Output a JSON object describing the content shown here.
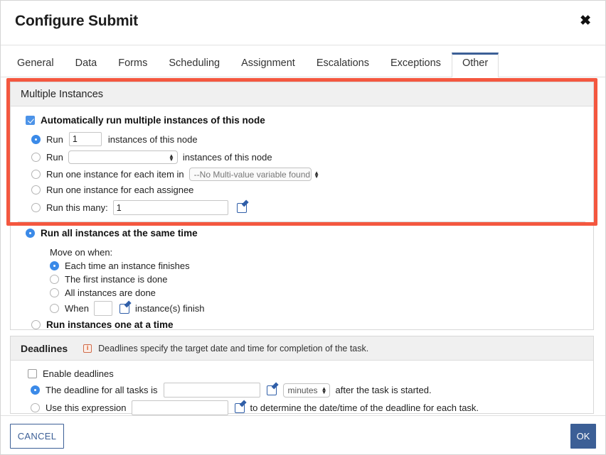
{
  "dialog": {
    "title": "Configure Submit",
    "close_label": "✖"
  },
  "tabs": [
    {
      "label": "General",
      "active": false
    },
    {
      "label": "Data",
      "active": false
    },
    {
      "label": "Forms",
      "active": false
    },
    {
      "label": "Scheduling",
      "active": false
    },
    {
      "label": "Assignment",
      "active": false
    },
    {
      "label": "Escalations",
      "active": false
    },
    {
      "label": "Exceptions",
      "active": false
    },
    {
      "label": "Other",
      "active": true
    }
  ],
  "multiple_instances": {
    "section_title": "Multiple Instances",
    "auto_run_label": "Automatically run multiple instances of this node",
    "auto_run_checked": true,
    "run_count": {
      "prefix": "Run",
      "value": "1",
      "suffix": "instances of this node",
      "selected": true
    },
    "run_variable": {
      "prefix": "Run",
      "select_value": "",
      "suffix": "instances of this node",
      "selected": false
    },
    "run_each_item": {
      "label": "Run one instance for each item in",
      "select_value": "--No Multi-value variable found",
      "selected": false
    },
    "run_each_assignee": {
      "label": "Run one instance for each assignee",
      "selected": false
    },
    "run_this_many": {
      "label": "Run this many:",
      "value": "1",
      "selected": false,
      "edit_icon": "edit-pencil-icon"
    },
    "run_all_same_time": {
      "label": "Run all instances at the same time",
      "selected": true
    },
    "move_on_when": {
      "label": "Move on when:",
      "options": [
        {
          "label": "Each time an instance finishes",
          "selected": true
        },
        {
          "label": "The first instance is done",
          "selected": false
        },
        {
          "label": "All instances are done",
          "selected": false
        }
      ],
      "when_row": {
        "prefix": "When",
        "value": "",
        "suffix": "instance(s) finish",
        "selected": false,
        "edit_icon": "edit-pencil-icon"
      }
    },
    "run_one_at_a_time": {
      "label": "Run instances one at a time",
      "selected": false
    }
  },
  "deadlines": {
    "section_title": "Deadlines",
    "info_icon": "info-icon",
    "info_text": "Deadlines specify the target date and time for completion of the task.",
    "enable": {
      "label": "Enable deadlines",
      "checked": false
    },
    "all_tasks": {
      "prefix": "The deadline for all tasks is",
      "value": "",
      "unit": "minutes",
      "suffix": "after the task is started.",
      "selected": true,
      "edit_icon": "edit-pencil-icon"
    },
    "expression": {
      "prefix": "Use this expression",
      "value": "",
      "suffix": "to determine the date/time of the deadline for each task.",
      "selected": false,
      "edit_icon": "edit-pencil-icon"
    }
  },
  "footer": {
    "cancel_label": "CANCEL",
    "ok_label": "OK"
  },
  "colors": {
    "accent_blue": "#3c5f96",
    "highlight_red": "#f4573f",
    "radio_blue": "#3b8ae8",
    "checkbox_blue": "#4c93e8",
    "info_orange": "#e0561f",
    "panel_head_gray": "#f0f0f0"
  }
}
